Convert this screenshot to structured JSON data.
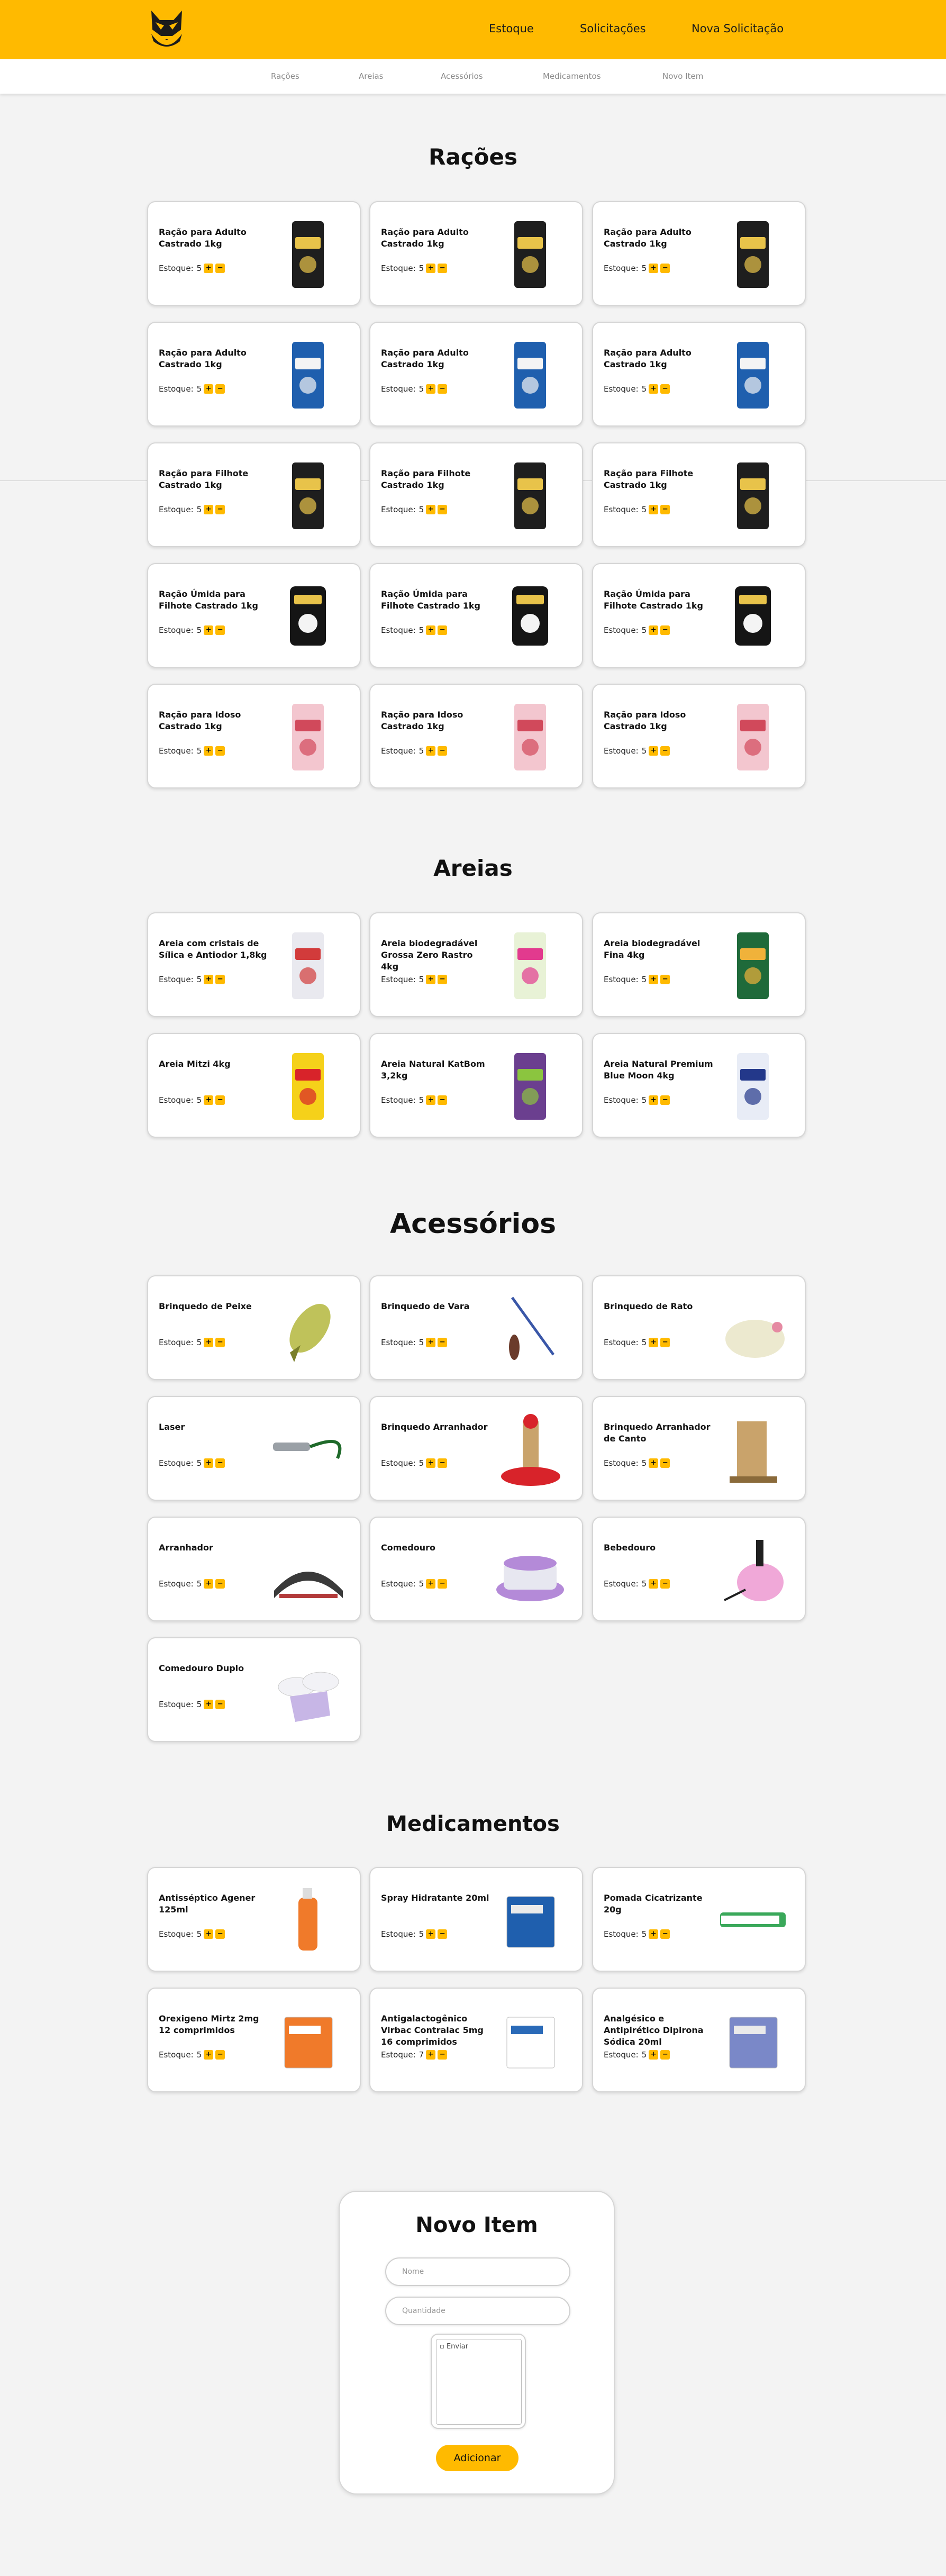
{
  "header": {
    "nav": [
      "Estoque",
      "Solicitações",
      "Nova Solicitação"
    ],
    "colors": {
      "accent": "#ffba00",
      "background": "#f3f3f3"
    }
  },
  "subnav": [
    "Rações",
    "Areias",
    "Acessórios",
    "Medicamentos",
    "Novo Item"
  ],
  "stock_label": "Estoque:",
  "sections": [
    {
      "title": "Rações",
      "items": [
        {
          "name": "Ração para Adulto Castrado 1kg",
          "stock": "5",
          "icon": "black-food-bag"
        },
        {
          "name": "Ração para Adulto Castrado 1kg",
          "stock": "5",
          "icon": "black-food-bag"
        },
        {
          "name": "Ração para Adulto Castrado 1kg",
          "stock": "5",
          "icon": "black-food-bag"
        },
        {
          "name": "Ração para Adulto Castrado 1kg",
          "stock": "5",
          "icon": "blue-food-bag"
        },
        {
          "name": "Ração para Adulto Castrado 1kg",
          "stock": "5",
          "icon": "blue-food-bag"
        },
        {
          "name": "Ração para Adulto Castrado 1kg",
          "stock": "5",
          "icon": "blue-food-bag"
        },
        {
          "name": "Ração para Filhote Castrado 1kg",
          "stock": "5",
          "icon": "black-food-bag"
        },
        {
          "name": "Ração para Filhote Castrado 1kg",
          "stock": "5",
          "icon": "black-food-bag"
        },
        {
          "name": "Ração para Filhote Castrado 1kg",
          "stock": "5",
          "icon": "black-food-bag"
        },
        {
          "name": "Ração Úmida para Filhote Castrado 1kg",
          "stock": "5",
          "icon": "wet-food-pouch"
        },
        {
          "name": "Ração Úmida para Filhote Castrado 1kg",
          "stock": "5",
          "icon": "wet-food-pouch"
        },
        {
          "name": "Ração Úmida para Filhote Castrado 1kg",
          "stock": "5",
          "icon": "wet-food-pouch"
        },
        {
          "name": "Ração para Idoso Castrado 1kg",
          "stock": "5",
          "icon": "pink-food-bag"
        },
        {
          "name": "Ração para Idoso Castrado 1kg",
          "stock": "5",
          "icon": "pink-food-bag"
        },
        {
          "name": "Ração para Idoso Castrado 1kg",
          "stock": "5",
          "icon": "pink-food-bag"
        }
      ]
    },
    {
      "title": "Areias",
      "items": [
        {
          "name": "Areia com cristais de Sílica e Antiodor 1,8kg",
          "stock": "5",
          "icon": "silica-litter-bag"
        },
        {
          "name": "Areia biodegradável Grossa Zero Rastro 4kg",
          "stock": "5",
          "icon": "pink-litter-bag"
        },
        {
          "name": "Areia biodegradável Fina 4kg",
          "stock": "5",
          "icon": "green-litter-bag"
        },
        {
          "name": "Areia Mitzi 4kg",
          "stock": "5",
          "icon": "yellow-litter-bag"
        },
        {
          "name": "Areia Natural KatBom 3,2kg",
          "stock": "5",
          "icon": "katbom-litter-bag"
        },
        {
          "name": "Areia Natural Premium Blue Moon 4kg",
          "stock": "5",
          "icon": "blue-moon-litter-bag"
        }
      ]
    },
    {
      "title": "Acessórios",
      "items": [
        {
          "name": "Brinquedo de Peixe",
          "stock": "5",
          "icon": "fish-toy"
        },
        {
          "name": "Brinquedo de Vara",
          "stock": "5",
          "icon": "wand-toy"
        },
        {
          "name": "Brinquedo de Rato",
          "stock": "5",
          "icon": "mouse-toy"
        },
        {
          "name": "Laser",
          "stock": "5",
          "icon": "laser-pointer"
        },
        {
          "name": "Brinquedo Arranhador",
          "stock": "5",
          "icon": "scratcher-post"
        },
        {
          "name": "Brinquedo Arranhador de Canto",
          "stock": "5",
          "icon": "corner-scratcher"
        },
        {
          "name": "Arranhador",
          "stock": "5",
          "icon": "scratcher-pad"
        },
        {
          "name": "Comedouro",
          "stock": "5",
          "icon": "feeder-bowl"
        },
        {
          "name": "Bebedouro",
          "stock": "5",
          "icon": "water-fountain"
        },
        {
          "name": "Comedouro Duplo",
          "stock": "5",
          "icon": "double-feeder"
        }
      ]
    },
    {
      "title": "Medicamentos",
      "items": [
        {
          "name": "Antisséptico Agener 125ml",
          "stock": "5",
          "icon": "antiseptic-bottle"
        },
        {
          "name": "Spray Hidratante 20ml",
          "stock": "5",
          "icon": "spray-box"
        },
        {
          "name": "Pomada Cicatrizante 20g",
          "stock": "5",
          "icon": "ointment-tube"
        },
        {
          "name": "Orexigeno Mirtz 2mg 12 comprimidos",
          "stock": "5",
          "icon": "mirtz-box"
        },
        {
          "name": "Antigalactogênico Virbac Contralac 5mg 16 comprimidos",
          "stock": "7",
          "icon": "contralac-box"
        },
        {
          "name": "Analgésico e Antipirético Dipirona Sódica 20ml",
          "stock": "5",
          "icon": "dipirona-box"
        }
      ]
    }
  ],
  "form": {
    "title": "Novo Item",
    "name_placeholder": "Nome",
    "quantity_placeholder": "Quantidade",
    "image_alt": "Enviar",
    "submit_label": "Adicionar"
  }
}
